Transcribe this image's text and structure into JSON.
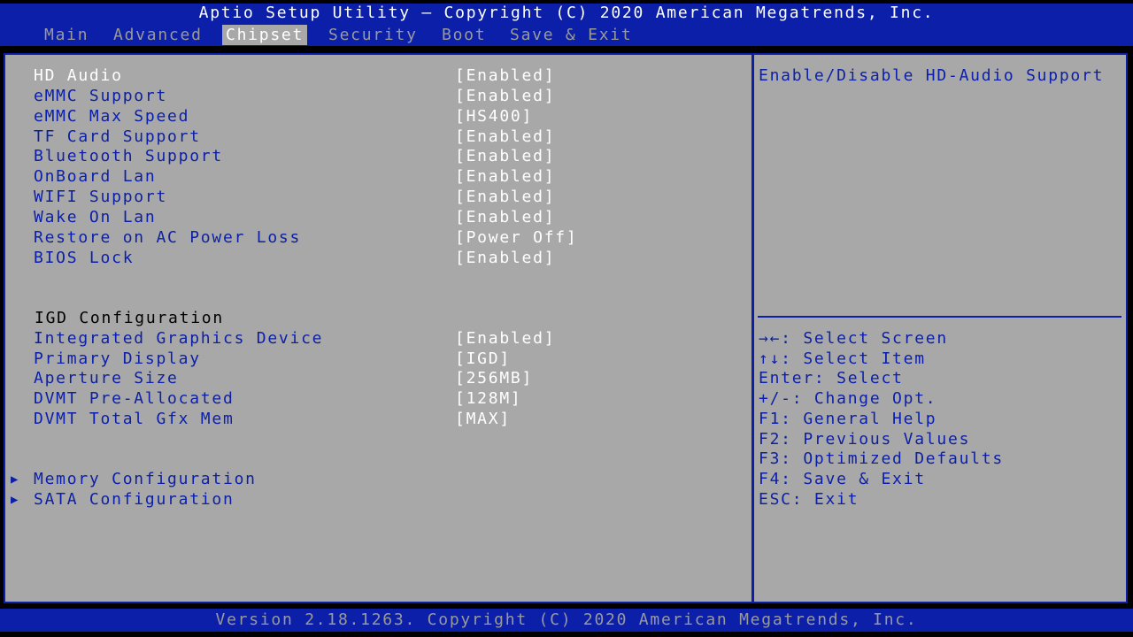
{
  "header": {
    "title": "Aptio Setup Utility – Copyright (C) 2020 American Megatrends, Inc."
  },
  "tabs": [
    {
      "label": "Main"
    },
    {
      "label": "Advanced"
    },
    {
      "label": "Chipset"
    },
    {
      "label": "Security"
    },
    {
      "label": "Boot"
    },
    {
      "label": "Save & Exit"
    }
  ],
  "active_tab": "Chipset",
  "settings": [
    {
      "label": "HD Audio",
      "value": "[Enabled]"
    },
    {
      "label": "eMMC Support",
      "value": "[Enabled]"
    },
    {
      "label": "eMMC Max Speed",
      "value": "[HS400]"
    },
    {
      "label": "TF Card Support",
      "value": "[Enabled]"
    },
    {
      "label": "Bluetooth Support",
      "value": "[Enabled]"
    },
    {
      "label": "OnBoard Lan",
      "value": "[Enabled]"
    },
    {
      "label": "WIFI Support",
      "value": "[Enabled]"
    },
    {
      "label": "Wake On Lan",
      "value": "[Enabled]"
    },
    {
      "label": "Restore on AC Power Loss",
      "value": "[Power Off]"
    },
    {
      "label": "BIOS Lock",
      "value": "[Enabled]"
    }
  ],
  "igd": {
    "heading": "IGD Configuration",
    "items": [
      {
        "label": "Integrated Graphics Device",
        "value": "[Enabled]"
      },
      {
        "label": "Primary Display",
        "value": "[IGD]"
      },
      {
        "label": "Aperture Size",
        "value": "[256MB]"
      },
      {
        "label": "DVMT Pre-Allocated",
        "value": "[128M]"
      },
      {
        "label": "DVMT Total Gfx Mem",
        "value": "[MAX]"
      }
    ]
  },
  "submenus": [
    {
      "label": "Memory Configuration"
    },
    {
      "label": "SATA Configuration"
    }
  ],
  "help": {
    "description": "Enable/Disable HD-Audio Support",
    "keys": [
      "→←: Select Screen",
      "↑↓: Select Item",
      "Enter: Select",
      "+/-: Change Opt.",
      "F1: General Help",
      "F2: Previous Values",
      "F3: Optimized Defaults",
      "F4: Save & Exit",
      "ESC: Exit"
    ]
  },
  "footer": {
    "text": "Version 2.18.1263. Copyright (C) 2020 American Megatrends, Inc."
  },
  "colors": {
    "panel": "#a8a8a8",
    "bar": "#0b1fa8",
    "text_blue": "#0b1fa8",
    "text_white": "#ffffff",
    "tab_inactive": "#9a9a9a"
  }
}
